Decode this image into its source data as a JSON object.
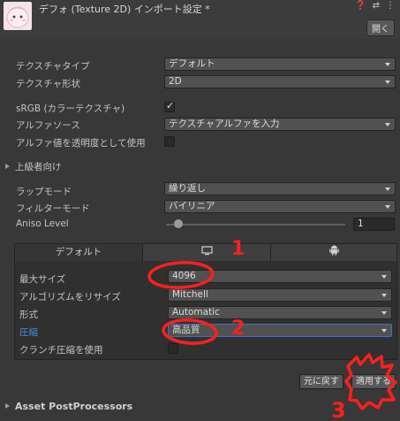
{
  "header": {
    "title": "デフォ (Texture 2D) インポート設定 *",
    "icons": [
      "help-icon",
      "preset-icon",
      "more-icon"
    ],
    "open_label": "開く"
  },
  "fields": {
    "texture_type": {
      "label": "テクスチャタイプ",
      "value": "デフォルト"
    },
    "texture_shape": {
      "label": "テクスチャ形状",
      "value": "2D"
    },
    "srgb": {
      "label": "sRGB (カラーテクスチャ)",
      "checked": true
    },
    "alpha_source": {
      "label": "アルファソース",
      "value": "テクスチャアルファを入力"
    },
    "alpha_transparency": {
      "label": "アルファ値を透明度として使用",
      "checked": false
    }
  },
  "advanced": {
    "label": "上級者向け"
  },
  "wrap": {
    "wrap_mode": {
      "label": "ラップモード",
      "value": "繰り返し"
    },
    "filter_mode": {
      "label": "フィルターモード",
      "value": "バイリニア"
    },
    "aniso": {
      "label": "Aniso Level",
      "value": "1"
    }
  },
  "platform": {
    "tabs": [
      {
        "label": "デフォルト",
        "icon": ""
      },
      {
        "label": "",
        "icon": "monitor-icon"
      },
      {
        "label": "",
        "icon": "android-icon"
      }
    ],
    "max_size": {
      "label": "最大サイズ",
      "value": "4096"
    },
    "resize_algorithm": {
      "label": "アルゴリズムをリサイズ",
      "value": "Mitchell"
    },
    "format": {
      "label": "形式",
      "value": "Automatic"
    },
    "compression": {
      "label": "圧縮",
      "value": "高品質"
    },
    "crunch": {
      "label": "クランチ圧縮を使用",
      "checked": false
    }
  },
  "actions": {
    "revert_label": "元に戻す",
    "apply_label": "適用する"
  },
  "postprocessors": {
    "label": "Asset PostProcessors"
  },
  "annotations": [
    "1",
    "2",
    "3"
  ],
  "colors": {
    "annotation": "#ff1f1f",
    "highlight_label": "#4c8fe0",
    "background": "#383838"
  }
}
